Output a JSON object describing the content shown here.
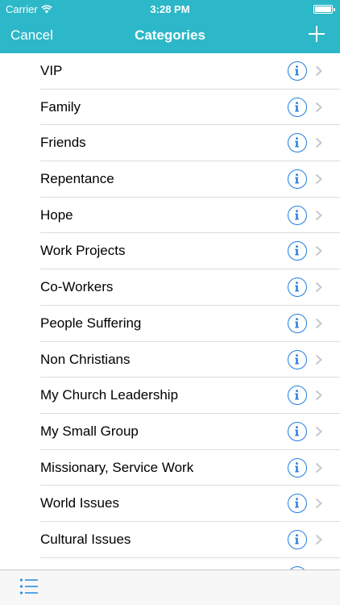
{
  "status_bar": {
    "carrier": "Carrier",
    "time": "3:28 PM"
  },
  "nav": {
    "cancel_label": "Cancel",
    "title": "Categories"
  },
  "colors": {
    "header_bg": "#2cb8c8",
    "accent_blue": "#1f7de0",
    "separator": "#dcdcdf"
  },
  "icons": {
    "add": "plus-icon",
    "info": "info-icon",
    "disclosure": "chevron-right-icon",
    "tab": "list-icon"
  },
  "categories": [
    "VIP",
    "Family",
    "Friends",
    "Repentance",
    "Hope",
    "Work Projects",
    "Co-Workers",
    "People Suffering",
    "Non Christians",
    "My Church Leadership",
    "My Small Group",
    "Missionary, Service Work",
    "World Issues",
    "Cultural Issues",
    ""
  ]
}
